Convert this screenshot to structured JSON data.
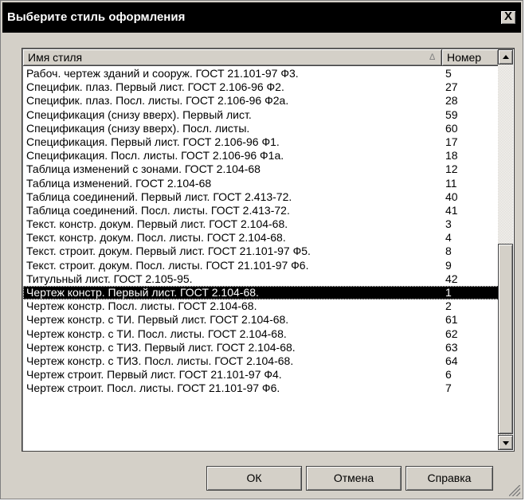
{
  "dialog": {
    "title": "Выберите стиль оформления",
    "close_label": "X"
  },
  "list": {
    "columns": [
      {
        "label": "Имя стиля",
        "sort_indicator": "∆"
      },
      {
        "label": "Номер"
      }
    ],
    "rows": [
      {
        "name": "Рабоч. чертеж зданий и сооруж. ГОСТ 21.101-97 Ф3.",
        "number": "5"
      },
      {
        "name": "Специфик. плаз. Первый лист. ГОСТ 2.106-96 Ф2.",
        "number": "27"
      },
      {
        "name": "Специфик. плаз. Посл. листы. ГОСТ 2.106-96 Ф2а.",
        "number": "28"
      },
      {
        "name": "Спецификация (снизу вверх). Первый лист.",
        "number": "59"
      },
      {
        "name": "Спецификация (снизу вверх). Посл. листы.",
        "number": "60"
      },
      {
        "name": "Спецификация. Первый лист. ГОСТ 2.106-96 Ф1.",
        "number": "17"
      },
      {
        "name": "Спецификация. Посл. листы. ГОСТ 2.106-96 Ф1а.",
        "number": "18"
      },
      {
        "name": "Таблица изменений с зонами. ГОСТ 2.104-68",
        "number": "12"
      },
      {
        "name": "Таблица изменений. ГОСТ 2.104-68",
        "number": "11"
      },
      {
        "name": "Таблица соединений. Первый лист. ГОСТ 2.413-72.",
        "number": "40"
      },
      {
        "name": "Таблица соединений. Посл. листы. ГОСТ 2.413-72.",
        "number": "41"
      },
      {
        "name": "Текст. констр. докум. Первый лист. ГОСТ 2.104-68.",
        "number": "3"
      },
      {
        "name": "Текст. констр. докум. Посл. листы. ГОСТ 2.104-68.",
        "number": "4"
      },
      {
        "name": "Текст. строит. докум. Первый лист. ГОСТ 21.101-97 Ф5.",
        "number": "8"
      },
      {
        "name": "Текст. строит. докум. Посл. листы. ГОСТ 21.101-97 Ф6.",
        "number": "9"
      },
      {
        "name": "Титульный лист. ГОСТ 2.105-95.",
        "number": "42"
      },
      {
        "name": "Чертеж констр. Первый лист. ГОСТ 2.104-68.",
        "number": "1",
        "selected": true
      },
      {
        "name": "Чертеж констр. Посл. листы. ГОСТ 2.104-68.",
        "number": "2"
      },
      {
        "name": "Чертеж констр. с ТИ. Первый лист. ГОСТ 2.104-68.",
        "number": "61"
      },
      {
        "name": "Чертеж констр. с ТИ. Посл. листы. ГОСТ 2.104-68.",
        "number": "62"
      },
      {
        "name": "Чертеж констр. с ТИЗ. Первый лист. ГОСТ 2.104-68.",
        "number": "63"
      },
      {
        "name": "Чертеж констр. с ТИЗ. Посл. листы. ГОСТ 2.104-68.",
        "number": "64"
      },
      {
        "name": "Чертеж строит. Первый лист. ГОСТ 21.101-97 Ф4.",
        "number": "6"
      },
      {
        "name": "Чертеж строит. Посл. листы.  ГОСТ 21.101-97 Ф6.",
        "number": "7"
      }
    ]
  },
  "buttons": {
    "ok": "ОК",
    "cancel": "Отмена",
    "help": "Справка"
  },
  "icons": {
    "scroll_up": "triangle-up-icon",
    "scroll_down": "triangle-down-icon",
    "resize_grip": "resize-grip-icon"
  }
}
